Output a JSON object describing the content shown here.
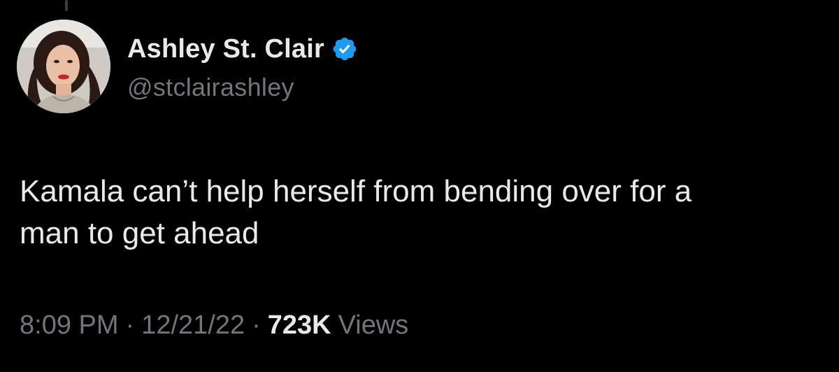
{
  "tweet": {
    "author": {
      "display_name": "Ashley St. Clair",
      "handle": "@stclairashley",
      "verified": true,
      "verified_badge_color": "#1d9bf0"
    },
    "text_lines": [
      "Kamala can’t help herself from bending over for a",
      "man to get ahead"
    ],
    "meta": {
      "time": "8:09 PM",
      "separator": "·",
      "date": "12/21/22",
      "views_count": "723K",
      "views_label": "Views"
    }
  },
  "colors": {
    "background": "#000000",
    "primary_text": "#e7e9ea",
    "secondary_text": "#71767b"
  }
}
